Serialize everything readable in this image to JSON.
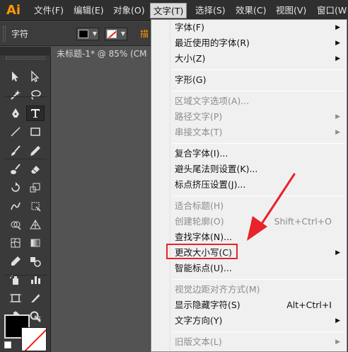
{
  "app": {
    "logo": "Ai"
  },
  "menubar": {
    "items": [
      {
        "label": "文件(F)"
      },
      {
        "label": "编辑(E)"
      },
      {
        "label": "对象(O)"
      },
      {
        "label": "文字(T)",
        "active": true
      },
      {
        "label": "选择(S)"
      },
      {
        "label": "效果(C)"
      },
      {
        "label": "视图(V)"
      },
      {
        "label": "窗口(W"
      }
    ]
  },
  "controlbar": {
    "label": "字符",
    "fill_color": "#000000",
    "stroke_color": "#ffffff",
    "accent_text": "描"
  },
  "document_tab": {
    "title": "未标题-1* @ 85% (CM"
  },
  "tools": {
    "icons": [
      "selection-arrow-icon",
      "direct-selection-icon",
      "magic-wand-icon",
      "lasso-icon",
      "pen-icon",
      "type-icon",
      "line-segment-icon",
      "rectangle-icon",
      "paintbrush-icon",
      "pencil-icon",
      "blob-brush-icon",
      "eraser-icon",
      "rotate-icon",
      "scale-icon",
      "warp-icon",
      "free-transform-icon",
      "shape-builder-icon",
      "perspective-grid-icon",
      "mesh-icon",
      "gradient-icon",
      "eyedropper-icon",
      "blend-icon",
      "symbol-sprayer-icon",
      "column-graph-icon",
      "artboard-icon",
      "slice-icon",
      "hand-icon",
      "zoom-icon"
    ],
    "selected": "type-icon"
  },
  "dropdown": {
    "items": [
      {
        "label": "字体(F)",
        "submenu": true
      },
      {
        "label": "最近使用的字体(R)",
        "submenu": true
      },
      {
        "label": "大小(Z)",
        "submenu": true
      },
      {
        "label": "字形(G)"
      },
      {
        "label": "区域文字选项(A)...",
        "disabled": true
      },
      {
        "label": "路径文字(P)",
        "disabled": true,
        "submenu": true
      },
      {
        "label": "串接文本(T)",
        "disabled": true,
        "submenu": true
      },
      {
        "label": "复合字体(I)..."
      },
      {
        "label": "避头尾法则设置(K)..."
      },
      {
        "label": "标点挤压设置(J)..."
      },
      {
        "label": "适合标题(H)",
        "disabled": true
      },
      {
        "label": "创建轮廓(O)",
        "disabled": true,
        "shortcut": "Shift+Ctrl+O"
      },
      {
        "label": "查找字体(N)..."
      },
      {
        "label": "更改大小写(C)",
        "submenu": true,
        "highlighted": true
      },
      {
        "label": "智能标点(U)..."
      },
      {
        "label": "视觉边距对齐方式(M)",
        "disabled": true
      },
      {
        "label": "显示隐藏字符(S)",
        "shortcut": "Alt+Ctrl+I"
      },
      {
        "label": "文字方向(Y)",
        "submenu": true
      },
      {
        "label": "旧版文本(L)",
        "disabled": true,
        "submenu": true
      }
    ]
  },
  "annotation": {
    "highlight_color": "#e8232a"
  }
}
